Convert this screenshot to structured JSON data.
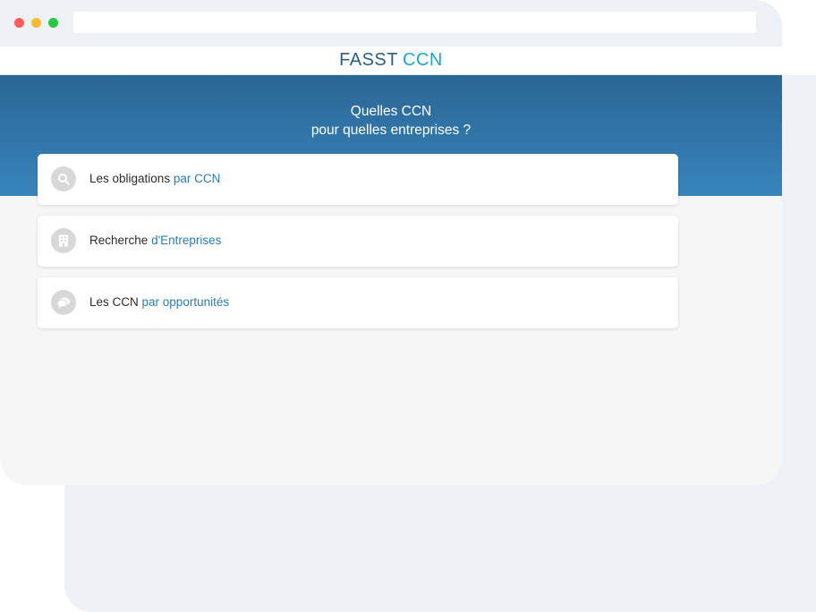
{
  "app": {
    "logo_part1": "FASST",
    "logo_part2": "CCN"
  },
  "hero": {
    "title_line1": "Quelles CCN",
    "title_line2": "pour quelles entreprises ?"
  },
  "menu": [
    {
      "icon": "search-icon",
      "label": "Les obligations",
      "accent": "par CCN"
    },
    {
      "icon": "building-icon",
      "label": "Recherche",
      "accent": "d'Entreprises"
    },
    {
      "icon": "chat-icon",
      "label": "Les CCN",
      "accent": "par opportunités"
    }
  ],
  "colors": {
    "accent": "#2a7bb5",
    "hero_top": "#2a6694",
    "hero_bottom": "#3884bd",
    "logo_dark": "#2b5f86",
    "logo_light": "#1aa8cf",
    "icon_bg": "#d8d8d8"
  }
}
